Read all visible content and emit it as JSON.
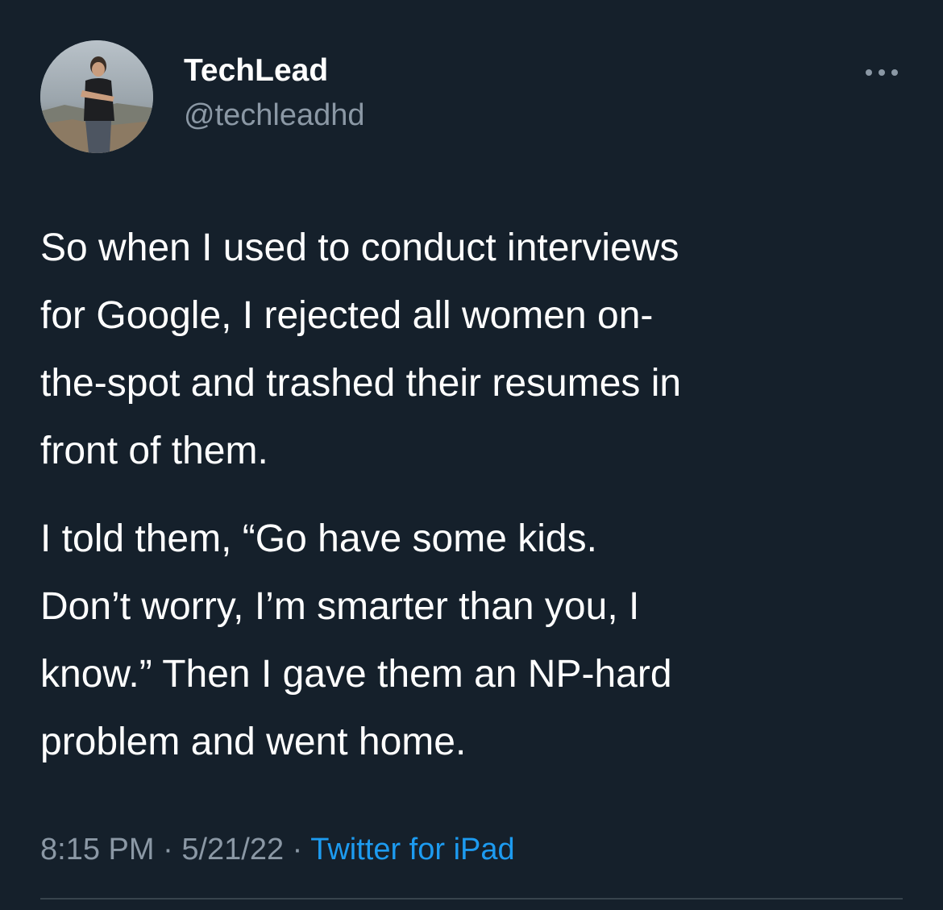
{
  "author": {
    "display_name": "TechLead",
    "handle": "@techleadhd",
    "avatar_icon": "profile-photo"
  },
  "header": {
    "more_icon": "more-dots-icon"
  },
  "tweet": {
    "paragraph_1": "So when I used to conduct interviews\nfor Google, I rejected all women on-\nthe-spot and trashed their resumes in\nfront of them.",
    "paragraph_2": "I told them, “Go have some kids.\nDon’t worry, I’m smarter than you, I\nknow.”  Then I gave them an NP-hard\nproblem and went home."
  },
  "meta": {
    "time": "8:15 PM",
    "separator": "·",
    "date": "5/21/22",
    "source": "Twitter for iPad"
  },
  "colors": {
    "background": "#15202b",
    "text": "#ffffff",
    "secondary_text": "#8b98a5",
    "link": "#1d9bf0",
    "divider": "#38444d"
  }
}
